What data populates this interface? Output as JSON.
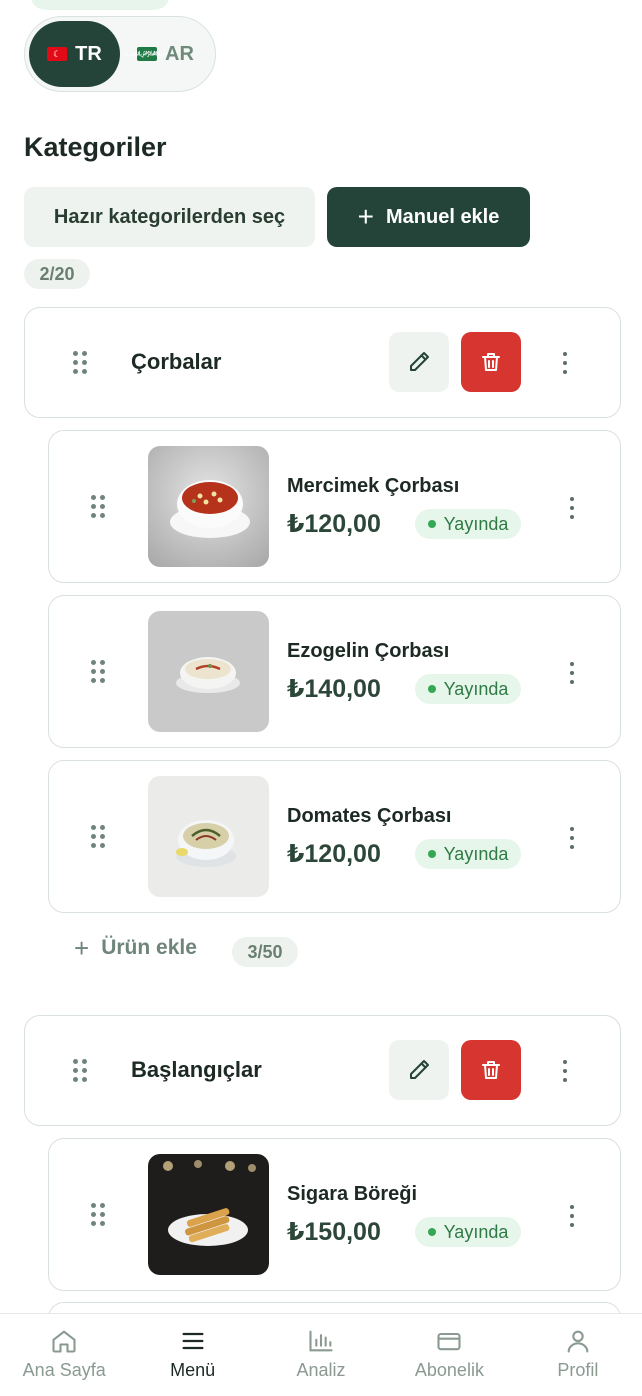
{
  "language_switch": {
    "tr": {
      "label": "TR",
      "flag": "🇹🇷",
      "active": true
    },
    "ar": {
      "label": "AR",
      "flag": "🇸🇦",
      "active": false
    }
  },
  "categories_section": {
    "title": "Kategoriler",
    "ready_button_label": "Hazır kategorilerden seç",
    "manual_button_label": "Manuel ekle",
    "count": "2/20"
  },
  "categories": [
    {
      "name": "Çorbalar",
      "items": [
        {
          "name": "Mercimek Çorbası",
          "price": "₺120,00",
          "status": "Yayında"
        },
        {
          "name": "Ezogelin Çorbası",
          "price": "₺140,00",
          "status": "Yayında"
        },
        {
          "name": "Domates Çorbası",
          "price": "₺120,00",
          "status": "Yayında"
        }
      ],
      "add_item_label": "Ürün ekle",
      "item_count": "3/50"
    },
    {
      "name": "Başlangıçlar",
      "items": [
        {
          "name": "Sigara Böreği",
          "price": "₺150,00",
          "status": "Yayında"
        }
      ]
    }
  ],
  "bottom_nav": [
    {
      "label": "Ana Sayfa",
      "icon": "home-icon",
      "active": false
    },
    {
      "label": "Menü",
      "icon": "menu-icon",
      "active": true
    },
    {
      "label": "Analiz",
      "icon": "chart-icon",
      "active": false
    },
    {
      "label": "Abonelik",
      "icon": "card-icon",
      "active": false
    },
    {
      "label": "Profil",
      "icon": "user-icon",
      "active": false
    }
  ],
  "colors": {
    "primary": "#24443a",
    "danger": "#d6362f",
    "status_green": "#34a853"
  }
}
